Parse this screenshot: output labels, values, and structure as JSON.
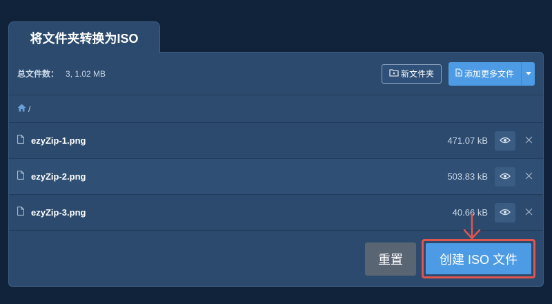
{
  "tab": {
    "title": "将文件夹转换为ISO"
  },
  "toolbar": {
    "total_label": "总文件数：",
    "total_value": "3, 1.02 MB",
    "new_folder_label": "新文件夹",
    "add_files_label": "添加更多文件"
  },
  "path": {
    "separator": "/"
  },
  "files": [
    {
      "name": "ezyZip-1.png",
      "size": "471.07 kB"
    },
    {
      "name": "ezyZip-2.png",
      "size": "503.83 kB"
    },
    {
      "name": "ezyZip-3.png",
      "size": "40.66 kB"
    }
  ],
  "actions": {
    "reset_label": "重置",
    "create_label": "创建 ISO 文件"
  },
  "colors": {
    "background": "#11233a",
    "panel": "#2b4a6e",
    "accent": "#4d9be4",
    "reset": "#5a6573",
    "highlight": "#e0564f"
  },
  "icons": {
    "home": "home-icon",
    "file": "file-icon",
    "eye": "eye-icon",
    "close": "close-icon",
    "folder": "folder-icon",
    "add_file": "file-plus-icon",
    "caret": "caret-down-icon",
    "arrow": "arrow-down-icon"
  }
}
